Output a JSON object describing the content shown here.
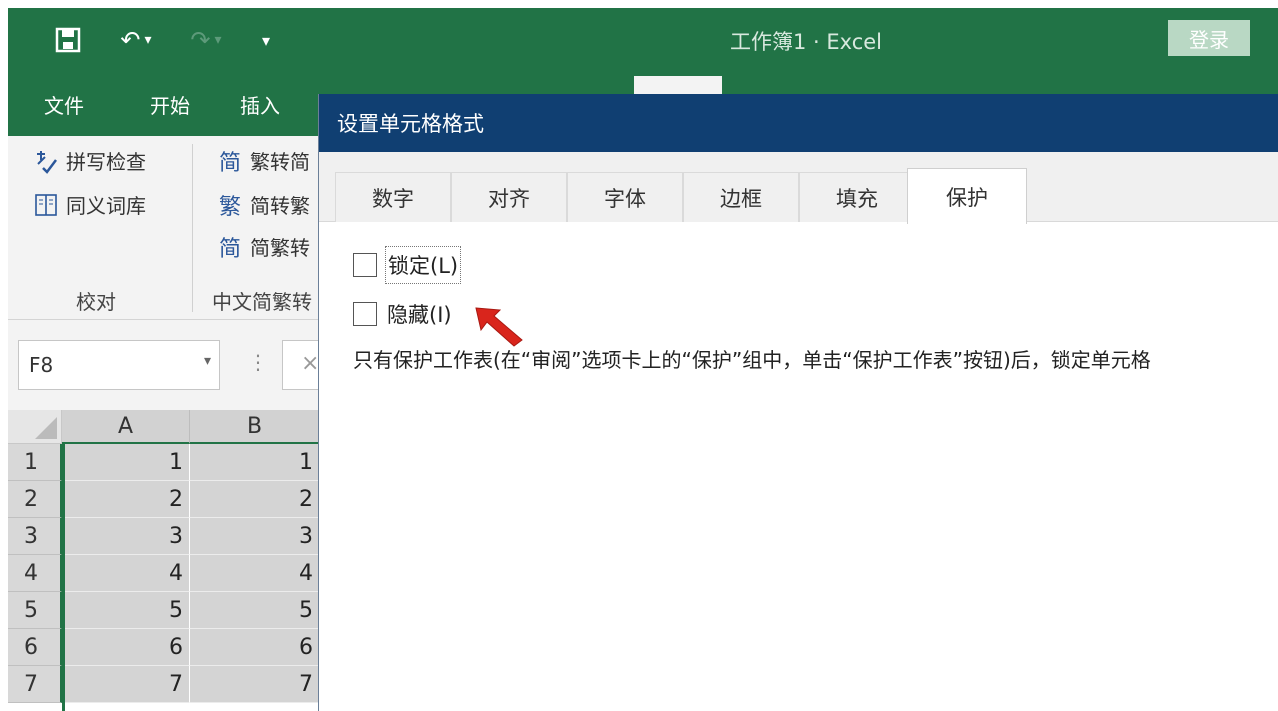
{
  "titlebar": {
    "doc_title": "工作簿1 · Excel",
    "login_label": "登录",
    "undo_glyph": "↶",
    "redo_glyph": "↷",
    "dropdown_glyph": "▾",
    "customize_glyph": "▾"
  },
  "ribbon": {
    "tabs": [
      {
        "label": "文件"
      },
      {
        "label": "开始"
      },
      {
        "label": "插入"
      }
    ],
    "proofing": {
      "spell_check": "拼写检查",
      "thesaurus": "同义词库",
      "group_label": "校对"
    },
    "chinese_conversion": {
      "trad_to_simp": "繁转简",
      "simp_to_trad": "简转繁",
      "conversion": "简繁转",
      "group_label": "中文简繁转",
      "icon_trad_char": "简",
      "icon_simp_char": "繁",
      "icon_conv_char": "简"
    }
  },
  "formula_bar": {
    "name_box_value": "F8",
    "dots": "⋮",
    "cancel_glyph": "×"
  },
  "sheet": {
    "columns": [
      "A",
      "B"
    ],
    "rows": [
      {
        "num": "1",
        "a": "1",
        "b": "1"
      },
      {
        "num": "2",
        "a": "2",
        "b": "2"
      },
      {
        "num": "3",
        "a": "3",
        "b": "3"
      },
      {
        "num": "4",
        "a": "4",
        "b": "4"
      },
      {
        "num": "5",
        "a": "5",
        "b": "5"
      },
      {
        "num": "6",
        "a": "6",
        "b": "6"
      },
      {
        "num": "7",
        "a": "7",
        "b": "7"
      }
    ]
  },
  "dialog": {
    "title": "设置单元格格式",
    "tabs": [
      "数字",
      "对齐",
      "字体",
      "边框",
      "填充",
      "保护"
    ],
    "active_tab": "保护",
    "locked_label": "锁定(L)",
    "locked_checked": false,
    "hidden_label": "隐藏(I)",
    "hidden_checked": false,
    "info_text": "只有保护工作表(在“审阅”选项卡上的“保护”组中，单击“保护工作表”按钮)后，锁定单元格"
  },
  "colors": {
    "excel_green": "#217346",
    "dialog_title_blue": "#103f72",
    "annotation_arrow": "#d9251c"
  }
}
